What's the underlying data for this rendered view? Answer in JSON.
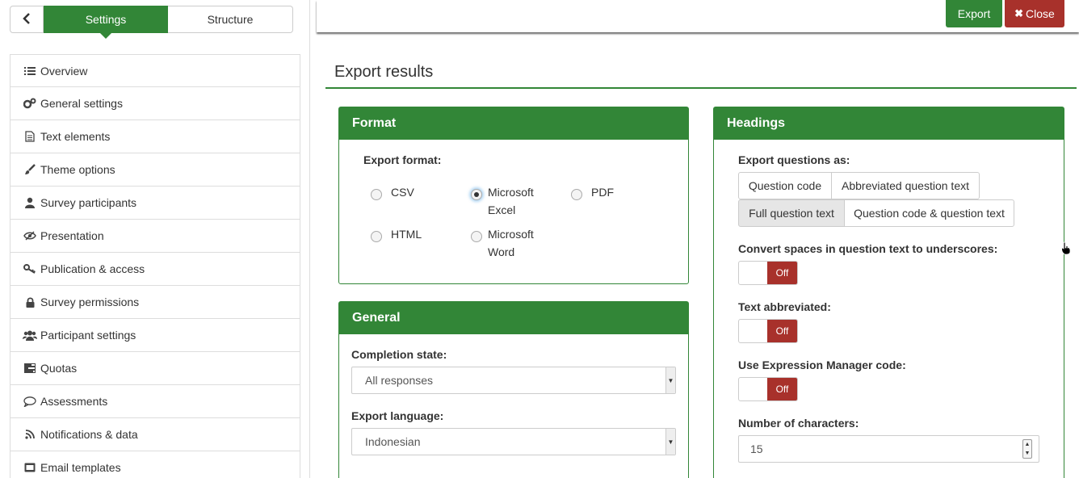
{
  "sidebar": {
    "back_icon": "chevron-left-icon",
    "tabs": [
      {
        "label": "Settings",
        "active": true
      },
      {
        "label": "Structure",
        "active": false
      }
    ],
    "items": [
      {
        "label": "Overview",
        "icon": "list-icon"
      },
      {
        "label": "General settings",
        "icon": "gears-icon"
      },
      {
        "label": "Text elements",
        "icon": "file-text-icon"
      },
      {
        "label": "Theme options",
        "icon": "paintbrush-icon"
      },
      {
        "label": "Survey participants",
        "icon": "user-icon"
      },
      {
        "label": "Presentation",
        "icon": "eye-slash-icon"
      },
      {
        "label": "Publication & access",
        "icon": "key-icon"
      },
      {
        "label": "Survey permissions",
        "icon": "lock-icon"
      },
      {
        "label": "Participant settings",
        "icon": "users-icon"
      },
      {
        "label": "Quotas",
        "icon": "tasks-icon"
      },
      {
        "label": "Assessments",
        "icon": "comment-icon"
      },
      {
        "label": "Notifications & data",
        "icon": "rss-icon"
      },
      {
        "label": "Email templates",
        "icon": "envelope-icon"
      }
    ]
  },
  "toolbar": {
    "export_label": "Export",
    "close_label": "Close",
    "close_icon": "times-icon"
  },
  "page": {
    "title": "Export results"
  },
  "format_panel": {
    "heading": "Format",
    "export_format_label": "Export format:",
    "options": [
      {
        "label": "CSV",
        "checked": false
      },
      {
        "label": "Microsoft Excel",
        "checked": true
      },
      {
        "label": "PDF",
        "checked": false
      },
      {
        "label": "HTML",
        "checked": false
      },
      {
        "label": "Microsoft Word",
        "checked": false
      }
    ]
  },
  "general_panel": {
    "heading": "General",
    "completion_label": "Completion state:",
    "completion_value": "All responses",
    "language_label": "Export language:",
    "language_value": "Indonesian"
  },
  "headings_panel": {
    "heading": "Headings",
    "export_questions_label": "Export questions as:",
    "question_options": [
      {
        "label": "Question code",
        "active": false
      },
      {
        "label": "Abbreviated question text",
        "active": false
      },
      {
        "label": "Full question text",
        "active": true
      },
      {
        "label": "Question code & question text",
        "active": false
      }
    ],
    "convert_spaces_label": "Convert spaces in question text to underscores:",
    "convert_spaces_value": "Off",
    "text_abbreviated_label": "Text abbreviated:",
    "text_abbreviated_value": "Off",
    "em_code_label": "Use Expression Manager code:",
    "em_code_value": "Off",
    "num_chars_label": "Number of characters:",
    "num_chars_value": "15"
  },
  "colors": {
    "primary": "#328637",
    "danger": "#a8312b"
  }
}
